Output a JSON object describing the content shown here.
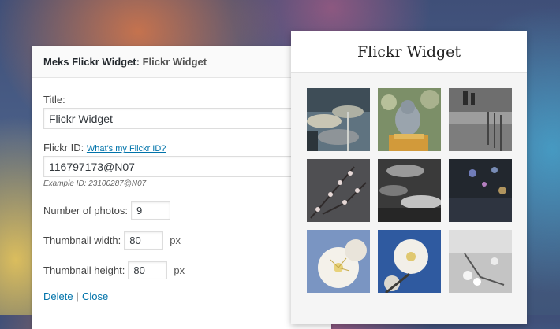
{
  "admin_widget": {
    "header_widget_name": "Meks Flickr Widget",
    "header_separator": ": ",
    "header_instance_title": "Flickr Widget",
    "title_label": "Title:",
    "title_value": "Flickr Widget",
    "flickr_id_label": "Flickr ID:",
    "flickr_id_help_link": "What's my Flickr ID?",
    "flickr_id_value": "116797173@N07",
    "flickr_id_example": "Example ID: 23100287@N07",
    "photos_label": "Number of photos:",
    "photos_value": "9",
    "thumb_width_label": "Thumbnail width:",
    "thumb_width_value": "80",
    "thumb_width_unit": "px",
    "thumb_height_label": "Thumbnail height:",
    "thumb_height_value": "80",
    "thumb_height_unit": "px",
    "delete_link": "Delete",
    "actions_separator": "|",
    "close_link": "Close"
  },
  "preview_widget": {
    "title": "Flickr Widget",
    "photos": [
      {
        "subject": "drum-kit-photo"
      },
      {
        "subject": "buddha-statue-photo"
      },
      {
        "subject": "rainy-street-photo"
      },
      {
        "subject": "blossom-branches-photo"
      },
      {
        "subject": "drum-cymbals-bw-photo"
      },
      {
        "subject": "night-city-bokeh-photo"
      },
      {
        "subject": "white-blossom-closeup-photo"
      },
      {
        "subject": "white-blossom-blue-sky-photo"
      },
      {
        "subject": "blossom-bw-photo"
      }
    ]
  }
}
